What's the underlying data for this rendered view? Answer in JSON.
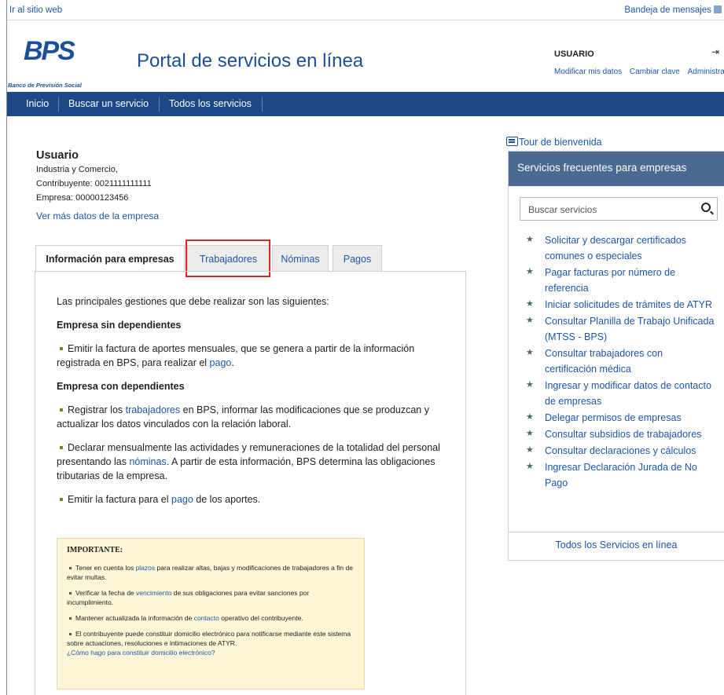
{
  "topbar": {
    "skip_link": "Ir al sitio web",
    "inbox_link": "Bandeja de mensajes"
  },
  "header": {
    "logo_text": "BPS",
    "logo_subtitle": "Banco de Previsión Social",
    "portal_title": "Portal de servicios en línea",
    "user_name": "USUARIO",
    "user_links": [
      "Modificar mis datos",
      "Cambiar clave",
      "Administra"
    ]
  },
  "nav": {
    "items": [
      "Inicio",
      "Buscar un servicio",
      "Todos los servicios"
    ]
  },
  "company": {
    "name": "Usuario",
    "sector": "Industria y Comercio,",
    "contribuyente": "Contribuyente: 0021111111111",
    "empresa": "Empresa:  00000123456",
    "more_link": "Ver más datos de la empresa"
  },
  "tabs": [
    "Información para empresas",
    "Trabajadores",
    "Nóminas",
    "Pagos"
  ],
  "content": {
    "intro": "Las principales gestiones que debe realizar son las siguientes:",
    "h1": "Empresa sin dependientes",
    "p1a": "Emitir la factura de aportes mensuales, que se genera a partir de la información registrada en BPS, para realizar el ",
    "p1_link": "pago",
    "p1b": ".",
    "h2": "Empresa con dependientes",
    "p2a": "Registrar los ",
    "p2_link": "trabajadores",
    "p2b": " en BPS, informar las modificaciones que se produzcan y actualizar los datos vinculados con la relación laboral.",
    "p3a": "Declarar mensualmente las actividades y remuneraciones de la totalidad del personal presentando las ",
    "p3_link": "nóminas",
    "p3b": ". A partir de esta información, BPS determina las obligaciones tributarias de la empresa.",
    "p4a": "Emitir la factura para el ",
    "p4_link": "pago",
    "p4b": " de los aportes."
  },
  "notice": {
    "title": "IMPORTANTE:",
    "n1a": "Tener en cuenta los ",
    "n1_link": "plazos",
    "n1b": " para realizar altas, bajas y modificaciones de trabajadores a fin de evitar multas.",
    "n2a": "Verificar la fecha de ",
    "n2_link": "vencimiento",
    "n2b": " de sus obligaciones para evitar sanciones por incumplimiento.",
    "n3a": "Mantener actualizada la información de ",
    "n3_link": "contacto",
    "n3b": " operativo del contribuyente.",
    "n4": "El contribuyente puede constituir domicilio electrónico para notificarse mediante este sistema sobre actuaciones, resoluciones e intimaciones de ATYR.",
    "n4_link": "¿Cómo hago para constituir domicilio electrónico?"
  },
  "sidebar": {
    "tour_link": "Tour de bienvenida",
    "title": "Servicios frecuentes para empresas",
    "search_placeholder": "Buscar servicios",
    "links": [
      "Solicitar y descargar certificados comunes o especiales",
      "Pagar facturas por número de referencia",
      "Iniciar solicitudes de trámites de ATYR",
      "Consultar Planilla de Trabajo Unificada (MTSS - BPS)",
      "Consultar trabajadores con certificación médica",
      "Ingresar y modificar datos de contacto de empresas",
      "Delegar permisos de empresas",
      "Consultar subsidios de trabajadores",
      "Consultar declaraciones y cálculos",
      "Ingresar Declaración Jurada de No Pago"
    ],
    "footer_link": "Todos los Servicios en línea"
  },
  "colors": {
    "nav_bg": "#1c4887",
    "sidebar_head": "#4a6a91",
    "link": "#1c57a5",
    "highlight": "#e02424",
    "notice_bg": "#fdf6d7"
  }
}
